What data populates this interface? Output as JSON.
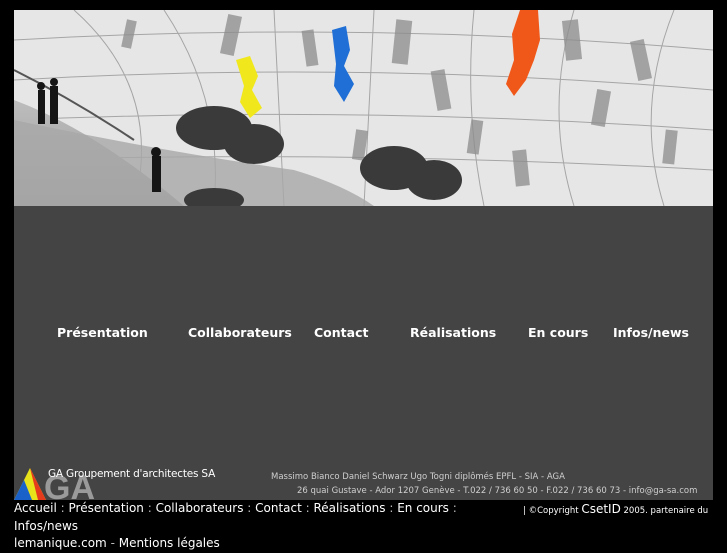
{
  "nav": {
    "items": [
      {
        "label": "Présentation"
      },
      {
        "label": "Collaborateurs"
      },
      {
        "label": "Contact"
      },
      {
        "label": "Réalisations"
      },
      {
        "label": "En cours"
      },
      {
        "label": "Infos/news"
      }
    ]
  },
  "company": {
    "logo_letters": "GA",
    "name": "GA Groupement d'architectes SA",
    "logo_colors": [
      "#e8e21a",
      "#e53a1c",
      "#1a62c9"
    ]
  },
  "contact": {
    "line1": "Massimo Bianco    Daniel Schwarz    Ugo Togni    diplômés   EPFL  -  SIA  -  AGA",
    "line2": "26 quai Gustave  -  Ador  1207 Genève  -  T.022 / 736 60 50  -  F.022 / 736 60 73   -  info@ga-sa.com"
  },
  "footer": {
    "links": [
      "Accueil",
      "Présentation",
      "Collaborateurs",
      "Contact",
      "Réalisations",
      "En cours",
      "Infos/news"
    ],
    "separator": " : ",
    "line2": [
      "lemanique.com",
      "Mentions légales"
    ],
    "line2_separator": " - ",
    "copyright_prefix": "| ©Copyright",
    "brand": "CsetID",
    "copyright_suffix": "2005. partenaire du"
  },
  "colors": {
    "panel": "#444444",
    "background": "#000000",
    "accent_yellow": "#f0e81c",
    "accent_blue": "#1f6fd6",
    "accent_orange": "#f0581a"
  }
}
